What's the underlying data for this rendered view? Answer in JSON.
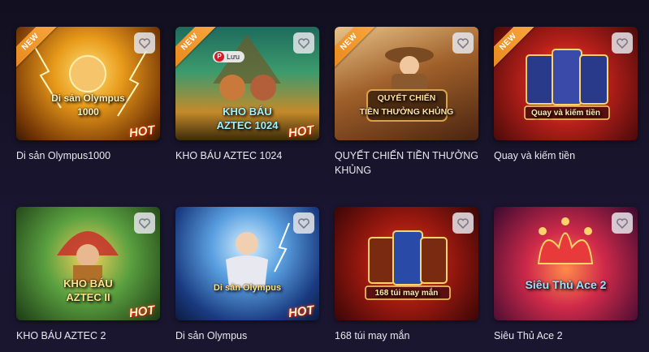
{
  "games": [
    {
      "title": "Di sản Olympus1000",
      "art_text": "Di sản Olympus\n1000",
      "new": true,
      "hot": true,
      "theme": "olympus"
    },
    {
      "title": "KHO BÁU AZTEC 1024",
      "art_text": "KHO BÁU\nAZTEC 1024",
      "new": true,
      "hot": true,
      "theme": "aztec",
      "save_label": "Lưu"
    },
    {
      "title": "QUYẾT CHIẾN TIỀN THƯỞNG KHỦNG",
      "art_text": "QUYẾT CHIẾN\nTIỀN THƯỞNG KHỦNG",
      "new": true,
      "hot": false,
      "theme": "western"
    },
    {
      "title": "Quay và kiếm tiền",
      "art_text": "Quay và kiếm tiền",
      "new": true,
      "hot": false,
      "theme": "cards"
    },
    {
      "title": "KHO BÁU AZTEC 2",
      "art_text": "KHO BÁU\nAZTEC II",
      "new": false,
      "hot": true,
      "theme": "aztec2"
    },
    {
      "title": "Di sản Olympus",
      "art_text": "Di sản Olympus",
      "new": false,
      "hot": true,
      "theme": "zeus"
    },
    {
      "title": "168 túi may mắn",
      "art_text": "168 túi may mắn",
      "new": false,
      "hot": false,
      "theme": "cards2"
    },
    {
      "title": "Siêu Thủ Ace 2",
      "art_text": "Siêu Thủ Ace 2",
      "new": false,
      "hot": false,
      "theme": "ace"
    }
  ],
  "labels": {
    "new": "NEW",
    "hot": "HOT"
  },
  "icons": {
    "favorite": "heart-icon",
    "save": "pin-icon"
  },
  "colors": {
    "background": "#15122a",
    "ribbon": "#f09a2e",
    "hot": "#ff4d00"
  }
}
